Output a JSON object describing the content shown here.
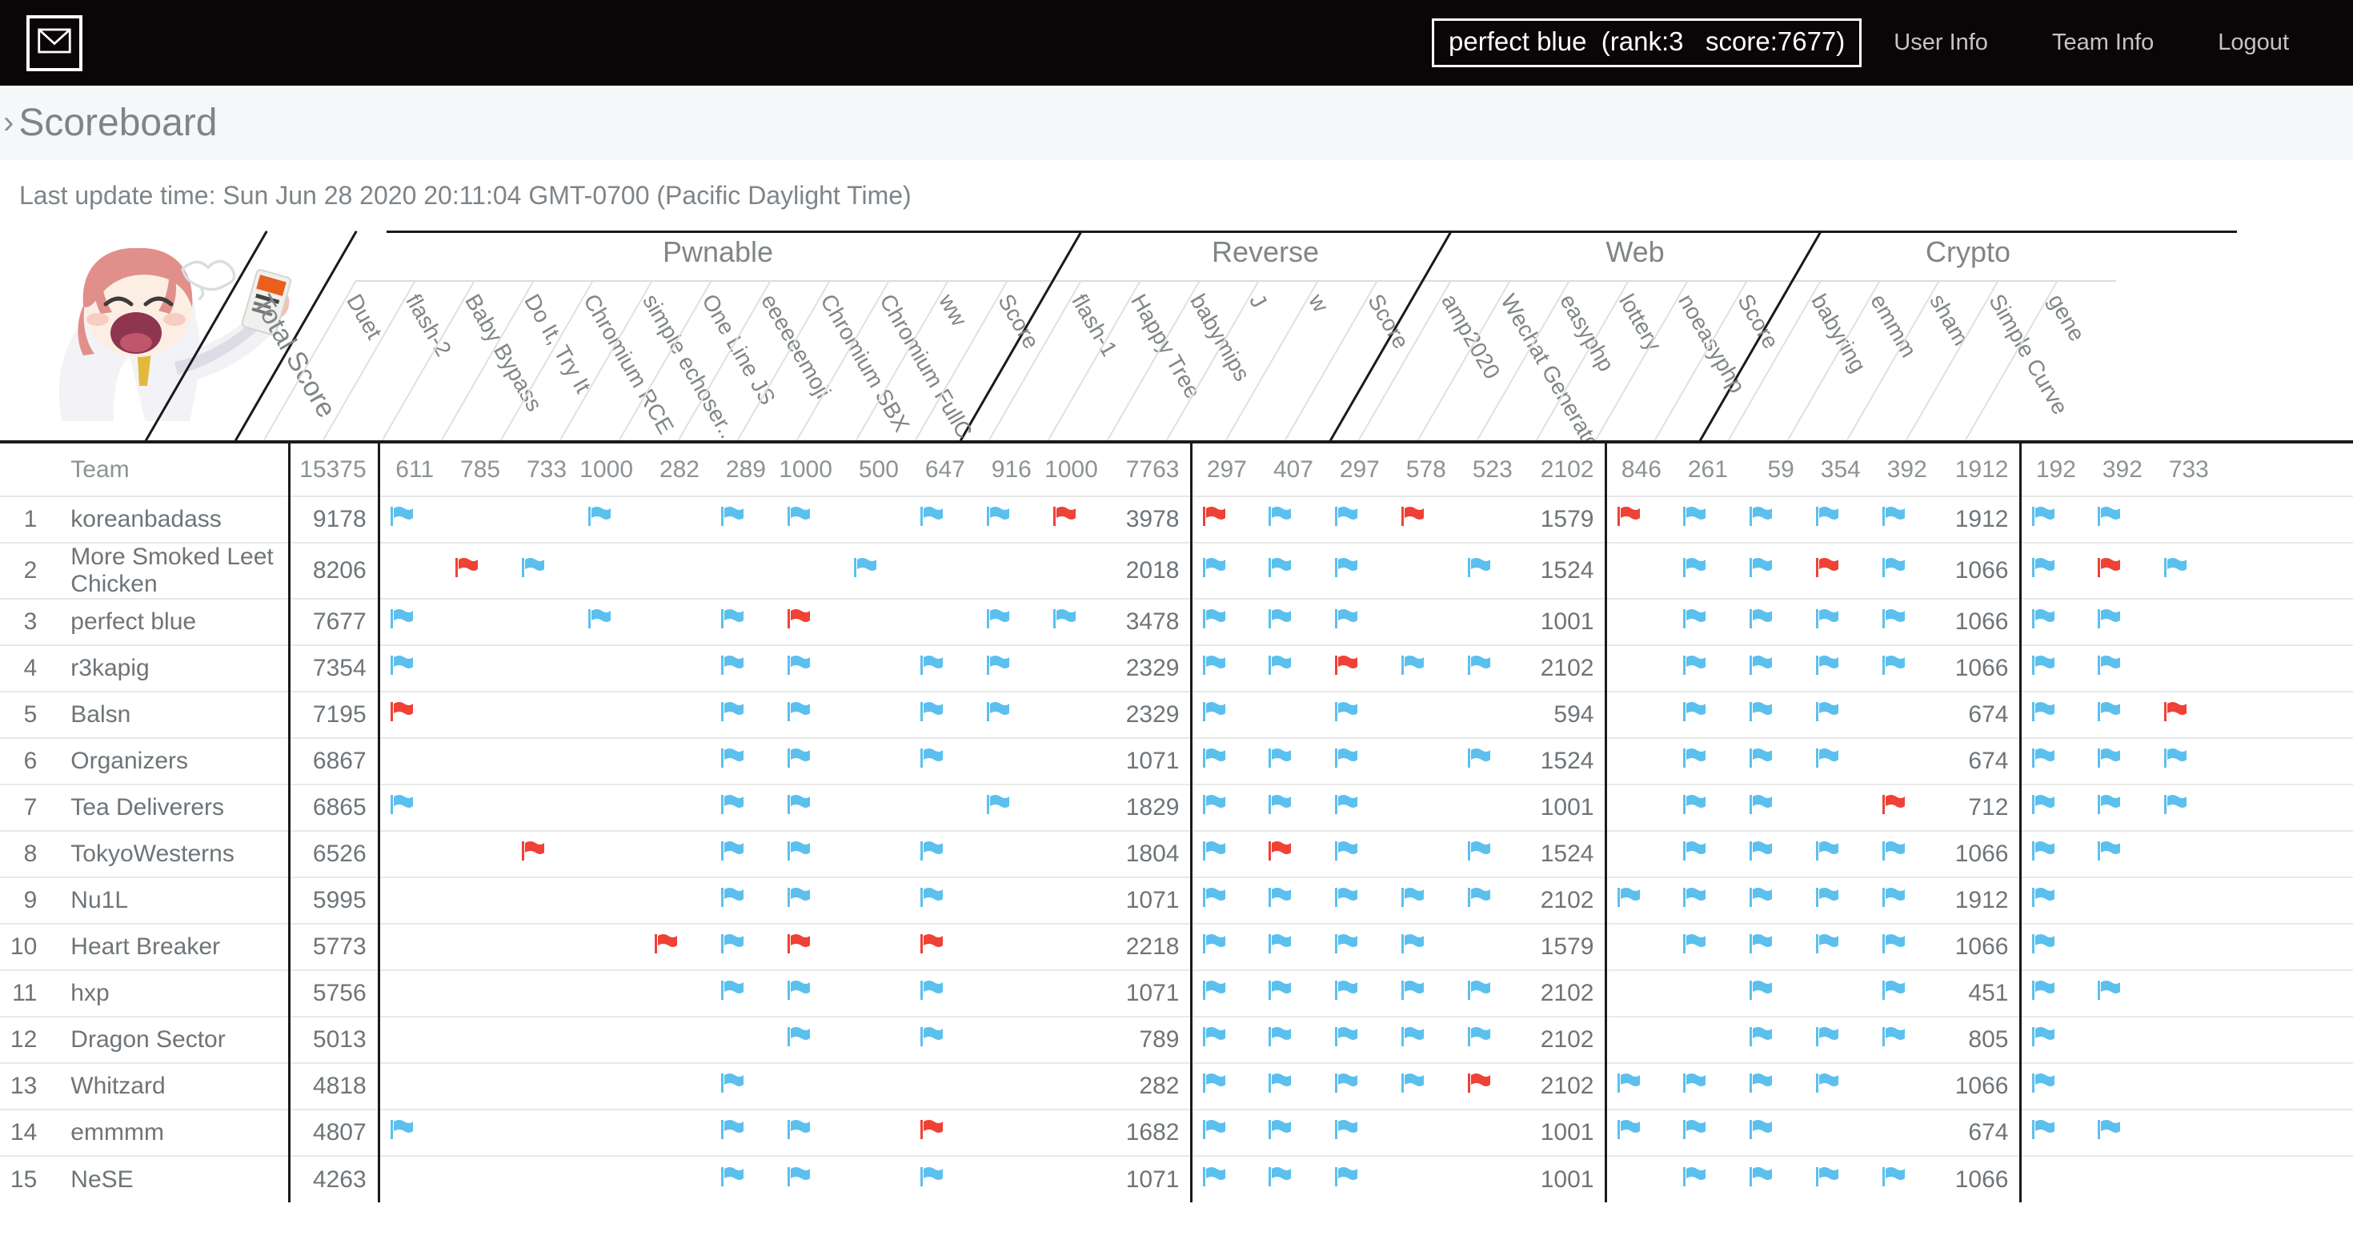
{
  "nav": {
    "mail_icon": "envelope-icon",
    "team_badge": "perfect blue  (rank:3   score:7677)",
    "links": [
      {
        "label": "User Info"
      },
      {
        "label": "Team Info"
      },
      {
        "label": "Logout"
      }
    ]
  },
  "page": {
    "chevron": "›",
    "title": "Scoreboard",
    "last_update": "Last update time: Sun Jun 28 2020 20:11:04 GMT-0700 (Pacific Daylight Time)"
  },
  "colors": {
    "flag_solved": "#5bc0ee",
    "flag_first": "#ef4136",
    "navbar_bg": "#0a0608",
    "text_muted": "#7e8488",
    "rule": "#1a1a1a"
  },
  "table": {
    "rank_header": "",
    "team_header": "Team",
    "total_label": "Total Score",
    "total_points": "15375",
    "score_col_label": "Score"
  },
  "categories": [
    {
      "name": "Pwnable",
      "score_points": "7763",
      "challenges": [
        {
          "name": "Duet",
          "points": "611"
        },
        {
          "name": "flash-2",
          "points": "785"
        },
        {
          "name": "Baby Bypass",
          "points": "733"
        },
        {
          "name": "Do It, Try It",
          "points": "1000"
        },
        {
          "name": "Chromium RCE",
          "points": "282"
        },
        {
          "name": "simple echoser...",
          "points": "289"
        },
        {
          "name": "One Line JS",
          "points": "1000"
        },
        {
          "name": "eeeeeemoji",
          "points": "500"
        },
        {
          "name": "Chromium SBX",
          "points": "647"
        },
        {
          "name": "Chromium FullC...",
          "points": "916"
        },
        {
          "name": "ww",
          "points": "1000"
        }
      ]
    },
    {
      "name": "Reverse",
      "score_points": "2102",
      "challenges": [
        {
          "name": "flash-1",
          "points": "297"
        },
        {
          "name": "Happy Tree",
          "points": "407"
        },
        {
          "name": "babymips",
          "points": "297"
        },
        {
          "name": "J",
          "points": "578"
        },
        {
          "name": "w",
          "points": "523"
        }
      ]
    },
    {
      "name": "Web",
      "score_points": "1912",
      "challenges": [
        {
          "name": "amp2020",
          "points": "846"
        },
        {
          "name": "Wechat Generator",
          "points": "261"
        },
        {
          "name": "easyphp",
          "points": "59"
        },
        {
          "name": "lottery",
          "points": "354"
        },
        {
          "name": "noeasyphp",
          "points": "392"
        }
      ]
    },
    {
      "name": "Crypto",
      "score_points": "",
      "challenges": [
        {
          "name": "babyring",
          "points": "192"
        },
        {
          "name": "emmm",
          "points": "392"
        },
        {
          "name": "sham",
          "points": "733"
        },
        {
          "name": "Simple Curve",
          "points": ""
        },
        {
          "name": "gene",
          "points": ""
        }
      ]
    }
  ],
  "rows": [
    {
      "rank": "1",
      "team": "koreanbadass",
      "total": "9178",
      "pwn": [
        "blue",
        "",
        "",
        "blue",
        "",
        "blue",
        "blue",
        "",
        "blue",
        "blue",
        "red"
      ],
      "pwn_score": "3978",
      "rev": [
        "red",
        "blue",
        "blue",
        "red",
        ""
      ],
      "rev_score": "1579",
      "web": [
        "red",
        "blue",
        "blue",
        "blue",
        "blue"
      ],
      "web_score": "1912",
      "cry": [
        "blue",
        "blue",
        "",
        "",
        ""
      ]
    },
    {
      "rank": "2",
      "team": "More Smoked Leet Chicken",
      "total": "8206",
      "pwn": [
        "",
        "red",
        "blue",
        "",
        "",
        "",
        "",
        "blue",
        "",
        "",
        ""
      ],
      "pwn_score": "2018",
      "rev": [
        "blue",
        "blue",
        "blue",
        "",
        "blue"
      ],
      "rev_score": "1524",
      "web": [
        "",
        "blue",
        "blue",
        "red",
        "blue"
      ],
      "web_score": "1066",
      "cry": [
        "blue",
        "red",
        "blue",
        "",
        ""
      ]
    },
    {
      "rank": "3",
      "team": "perfect blue",
      "total": "7677",
      "pwn": [
        "blue",
        "",
        "",
        "blue",
        "",
        "blue",
        "red",
        "",
        "",
        "blue",
        "blue"
      ],
      "pwn_score": "3478",
      "rev": [
        "blue",
        "blue",
        "blue",
        "",
        ""
      ],
      "rev_score": "1001",
      "web": [
        "",
        "blue",
        "blue",
        "blue",
        "blue"
      ],
      "web_score": "1066",
      "cry": [
        "blue",
        "blue",
        "",
        "",
        ""
      ]
    },
    {
      "rank": "4",
      "team": "r3kapig",
      "total": "7354",
      "pwn": [
        "blue",
        "",
        "",
        "",
        "",
        "blue",
        "blue",
        "",
        "blue",
        "blue",
        ""
      ],
      "pwn_score": "2329",
      "rev": [
        "blue",
        "blue",
        "red",
        "blue",
        "blue"
      ],
      "rev_score": "2102",
      "web": [
        "",
        "blue",
        "blue",
        "blue",
        "blue"
      ],
      "web_score": "1066",
      "cry": [
        "blue",
        "blue",
        "",
        "",
        ""
      ]
    },
    {
      "rank": "5",
      "team": "Balsn",
      "total": "7195",
      "pwn": [
        "red",
        "",
        "",
        "",
        "",
        "blue",
        "blue",
        "",
        "blue",
        "blue",
        ""
      ],
      "pwn_score": "2329",
      "rev": [
        "blue",
        "",
        "blue",
        "",
        ""
      ],
      "rev_score": "594",
      "web": [
        "",
        "blue",
        "blue",
        "blue",
        ""
      ],
      "web_score": "674",
      "cry": [
        "blue",
        "blue",
        "red",
        "",
        ""
      ]
    },
    {
      "rank": "6",
      "team": "Organizers",
      "total": "6867",
      "pwn": [
        "",
        "",
        "",
        "",
        "",
        "blue",
        "blue",
        "",
        "blue",
        "",
        ""
      ],
      "pwn_score": "1071",
      "rev": [
        "blue",
        "blue",
        "blue",
        "",
        "blue"
      ],
      "rev_score": "1524",
      "web": [
        "",
        "blue",
        "blue",
        "blue",
        ""
      ],
      "web_score": "674",
      "cry": [
        "blue",
        "blue",
        "blue",
        "",
        ""
      ]
    },
    {
      "rank": "7",
      "team": "Tea Deliverers",
      "total": "6865",
      "pwn": [
        "blue",
        "",
        "",
        "",
        "",
        "blue",
        "blue",
        "",
        "",
        "blue",
        ""
      ],
      "pwn_score": "1829",
      "rev": [
        "blue",
        "blue",
        "blue",
        "",
        ""
      ],
      "rev_score": "1001",
      "web": [
        "",
        "blue",
        "blue",
        "",
        "red"
      ],
      "web_score": "712",
      "cry": [
        "blue",
        "blue",
        "blue",
        "",
        ""
      ]
    },
    {
      "rank": "8",
      "team": "TokyoWesterns",
      "total": "6526",
      "pwn": [
        "",
        "",
        "red",
        "",
        "",
        "blue",
        "blue",
        "",
        "blue",
        "",
        ""
      ],
      "pwn_score": "1804",
      "rev": [
        "blue",
        "red",
        "blue",
        "",
        "blue"
      ],
      "rev_score": "1524",
      "web": [
        "",
        "blue",
        "blue",
        "blue",
        "blue"
      ],
      "web_score": "1066",
      "cry": [
        "blue",
        "blue",
        "",
        "",
        ""
      ]
    },
    {
      "rank": "9",
      "team": "Nu1L",
      "total": "5995",
      "pwn": [
        "",
        "",
        "",
        "",
        "",
        "blue",
        "blue",
        "",
        "blue",
        "",
        ""
      ],
      "pwn_score": "1071",
      "rev": [
        "blue",
        "blue",
        "blue",
        "blue",
        "blue"
      ],
      "rev_score": "2102",
      "web": [
        "blue",
        "blue",
        "blue",
        "blue",
        "blue"
      ],
      "web_score": "1912",
      "cry": [
        "blue",
        "",
        "",
        "",
        ""
      ]
    },
    {
      "rank": "10",
      "team": "Heart Breaker",
      "total": "5773",
      "pwn": [
        "",
        "",
        "",
        "",
        "red",
        "blue",
        "red",
        "",
        "red",
        "",
        ""
      ],
      "pwn_score": "2218",
      "rev": [
        "blue",
        "blue",
        "blue",
        "blue",
        ""
      ],
      "rev_score": "1579",
      "web": [
        "",
        "blue",
        "blue",
        "blue",
        "blue"
      ],
      "web_score": "1066",
      "cry": [
        "blue",
        "",
        "",
        "",
        ""
      ]
    },
    {
      "rank": "11",
      "team": "hxp",
      "total": "5756",
      "pwn": [
        "",
        "",
        "",
        "",
        "",
        "blue",
        "blue",
        "",
        "blue",
        "",
        ""
      ],
      "pwn_score": "1071",
      "rev": [
        "blue",
        "blue",
        "blue",
        "blue",
        "blue"
      ],
      "rev_score": "2102",
      "web": [
        "",
        "",
        "blue",
        "",
        "blue"
      ],
      "web_score": "451",
      "cry": [
        "blue",
        "blue",
        "",
        "",
        ""
      ]
    },
    {
      "rank": "12",
      "team": "Dragon Sector",
      "total": "5013",
      "pwn": [
        "",
        "",
        "",
        "",
        "",
        "",
        "blue",
        "",
        "blue",
        "",
        ""
      ],
      "pwn_score": "789",
      "rev": [
        "blue",
        "blue",
        "blue",
        "blue",
        "blue"
      ],
      "rev_score": "2102",
      "web": [
        "",
        "",
        "blue",
        "blue",
        "blue"
      ],
      "web_score": "805",
      "cry": [
        "blue",
        "",
        "",
        "",
        ""
      ]
    },
    {
      "rank": "13",
      "team": "Whitzard",
      "total": "4818",
      "pwn": [
        "",
        "",
        "",
        "",
        "",
        "blue",
        "",
        "",
        "",
        "",
        ""
      ],
      "pwn_score": "282",
      "rev": [
        "blue",
        "blue",
        "blue",
        "blue",
        "red"
      ],
      "rev_score": "2102",
      "web": [
        "blue",
        "blue",
        "blue",
        "blue",
        ""
      ],
      "web_score": "1066",
      "cry": [
        "blue",
        "",
        "",
        "",
        ""
      ]
    },
    {
      "rank": "14",
      "team": "emmmm",
      "total": "4807",
      "pwn": [
        "blue",
        "",
        "",
        "",
        "",
        "blue",
        "blue",
        "",
        "red",
        "",
        ""
      ],
      "pwn_score": "1682",
      "rev": [
        "blue",
        "blue",
        "blue",
        "",
        ""
      ],
      "rev_score": "1001",
      "web": [
        "blue",
        "blue",
        "blue",
        "",
        ""
      ],
      "web_score": "674",
      "cry": [
        "blue",
        "blue",
        "",
        "",
        ""
      ]
    },
    {
      "rank": "15",
      "team": "NeSE",
      "total": "4263",
      "pwn": [
        "",
        "",
        "",
        "",
        "",
        "blue",
        "blue",
        "",
        "blue",
        "",
        ""
      ],
      "pwn_score": "1071",
      "rev": [
        "blue",
        "blue",
        "blue",
        "",
        ""
      ],
      "rev_score": "1001",
      "web": [
        "",
        "blue",
        "blue",
        "blue",
        "blue"
      ],
      "web_score": "1066",
      "cry": [
        "",
        "",
        "",
        "",
        ""
      ]
    }
  ]
}
